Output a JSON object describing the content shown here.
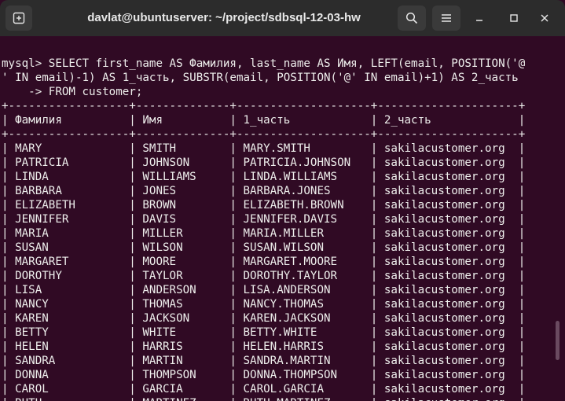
{
  "window": {
    "title": "davlat@ubuntuserver: ~/project/sdbsql-12-03-hw",
    "new_tab_icon": "new-tab-icon",
    "search_icon": "search-icon",
    "menu_icon": "hamburger-menu-icon",
    "minimize_icon": "minimize-icon",
    "maximize_icon": "maximize-icon",
    "close_icon": "close-icon"
  },
  "terminal": {
    "command_lines": [
      "mysql> SELECT first_name AS Фамилия, last_name AS Имя, LEFT(email, POSITION('@",
      "' IN email)-1) AS 1_часть, SUBSTR(email, POSITION('@' IN email)+1) AS 2_часть",
      "    -> FROM customer;"
    ],
    "table": {
      "border": "+------------------+--------------+--------------------+---------------------+",
      "headers": [
        "Фамилия",
        "Имя",
        "1_часть",
        "2_часть"
      ],
      "rows": [
        [
          "MARY",
          "SMITH",
          "MARY.SMITH",
          "sakilacustomer.org"
        ],
        [
          "PATRICIA",
          "JOHNSON",
          "PATRICIA.JOHNSON",
          "sakilacustomer.org"
        ],
        [
          "LINDA",
          "WILLIAMS",
          "LINDA.WILLIAMS",
          "sakilacustomer.org"
        ],
        [
          "BARBARA",
          "JONES",
          "BARBARA.JONES",
          "sakilacustomer.org"
        ],
        [
          "ELIZABETH",
          "BROWN",
          "ELIZABETH.BROWN",
          "sakilacustomer.org"
        ],
        [
          "JENNIFER",
          "DAVIS",
          "JENNIFER.DAVIS",
          "sakilacustomer.org"
        ],
        [
          "MARIA",
          "MILLER",
          "MARIA.MILLER",
          "sakilacustomer.org"
        ],
        [
          "SUSAN",
          "WILSON",
          "SUSAN.WILSON",
          "sakilacustomer.org"
        ],
        [
          "MARGARET",
          "MOORE",
          "MARGARET.MOORE",
          "sakilacustomer.org"
        ],
        [
          "DOROTHY",
          "TAYLOR",
          "DOROTHY.TAYLOR",
          "sakilacustomer.org"
        ],
        [
          "LISA",
          "ANDERSON",
          "LISA.ANDERSON",
          "sakilacustomer.org"
        ],
        [
          "NANCY",
          "THOMAS",
          "NANCY.THOMAS",
          "sakilacustomer.org"
        ],
        [
          "KAREN",
          "JACKSON",
          "KAREN.JACKSON",
          "sakilacustomer.org"
        ],
        [
          "BETTY",
          "WHITE",
          "BETTY.WHITE",
          "sakilacustomer.org"
        ],
        [
          "HELEN",
          "HARRIS",
          "HELEN.HARRIS",
          "sakilacustomer.org"
        ],
        [
          "SANDRA",
          "MARTIN",
          "SANDRA.MARTIN",
          "sakilacustomer.org"
        ],
        [
          "DONNA",
          "THOMPSON",
          "DONNA.THOMPSON",
          "sakilacustomer.org"
        ],
        [
          "CAROL",
          "GARCIA",
          "CAROL.GARCIA",
          "sakilacustomer.org"
        ],
        [
          "RUTH",
          "MARTINEZ",
          "RUTH.MARTINEZ",
          "sakilacustomer.org"
        ]
      ]
    }
  },
  "colors": {
    "terminal_bg": "#300a24",
    "terminal_fg": "#eeeeec",
    "titlebar_bg": "#2c2c2c"
  }
}
